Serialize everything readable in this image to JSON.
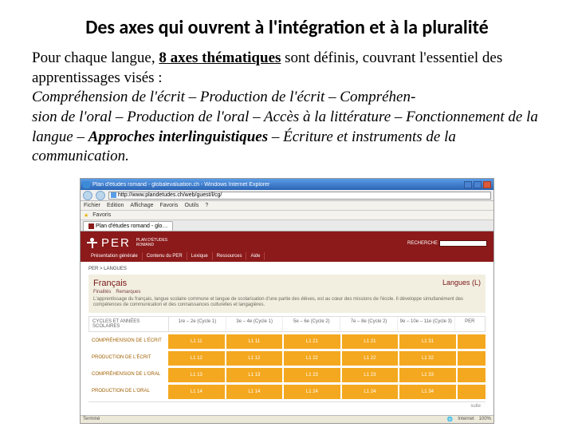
{
  "slide": {
    "title": "Des axes qui ouvrent à l'intégration et à la pluralité",
    "para_lead": "Pour chaque langue, ",
    "para_bold": "8 axes thématiques",
    "para_rest": " sont définis, couvrant l'essentiel des apprentissages visés :",
    "themes_line1": "Compréhension de l'écrit – Production de l'écrit – Compréhen-",
    "themes_line2": "sion de l'oral – Production de l'oral – Accès à la littérature – Fonctionnement de la langue – ",
    "themes_bold": "Approches interlinguistiques",
    "themes_line3": " – Écriture et instruments de la communication."
  },
  "browser": {
    "window_title": "Plan d'études romand - globalevaluation.ch - Windows Internet Explorer",
    "url": "http://www.plandetudes.ch/web/guest/l/cg/",
    "menu": [
      "Fichier",
      "Edition",
      "Affichage",
      "Favoris",
      "Outils",
      "?"
    ],
    "toolbar2": [
      "Favoris"
    ],
    "tab_label": "Plan d'études romand - glo…",
    "status_left": "Terminé",
    "status_right": "Internet",
    "zoom": "100%"
  },
  "per": {
    "logo_text": "PER",
    "logo_sub1": "PLAN D'ÉTUDES",
    "logo_sub2": "ROMAND",
    "search_label": "RECHERCHE",
    "nav": [
      "Présentation générale",
      "Contenu du PER",
      "Lexique",
      "Ressources",
      "Aide"
    ],
    "breadcrumb": "PER > LANGUES",
    "domain_title": "Français",
    "domain_badge": "Langues (L)",
    "sub_links": [
      "Finalités",
      "Remarques"
    ],
    "description": "L'apprentissage du français, langue scolaire commune et langue de scolarisation d'une partie des élèves, est au cœur des missions de l'école. Il développe simultanément des compétences de communication et des connaissances culturelles et langagières.",
    "cycle_label": "Cycles et années scolaires",
    "cycle_headers": [
      "1re – 2e (Cycle 1)",
      "3e – 4e (Cycle 1)",
      "5e – 6e (Cycle 2)",
      "7e – 8e (Cycle 2)",
      "9e – 10e – 11e (Cycle 3)",
      "PER"
    ],
    "axes": [
      {
        "label": "Compréhension de l'écrit",
        "cells": [
          "L1 11",
          "L1 11",
          "L1 21",
          "L1 21",
          "L1 31",
          ""
        ]
      },
      {
        "label": "Production de l'écrit",
        "cells": [
          "L1 12",
          "L1 12",
          "L1 22",
          "L1 22",
          "L1 32",
          ""
        ]
      },
      {
        "label": "Compréhension de l'oral",
        "cells": [
          "L1 13",
          "L1 13",
          "L1 23",
          "L1 23",
          "L1 33",
          ""
        ]
      },
      {
        "label": "Production de l'oral",
        "cells": [
          "L1 14",
          "L1 14",
          "L1 24",
          "L1 24",
          "L1 34",
          ""
        ]
      }
    ],
    "footer": "suite"
  }
}
